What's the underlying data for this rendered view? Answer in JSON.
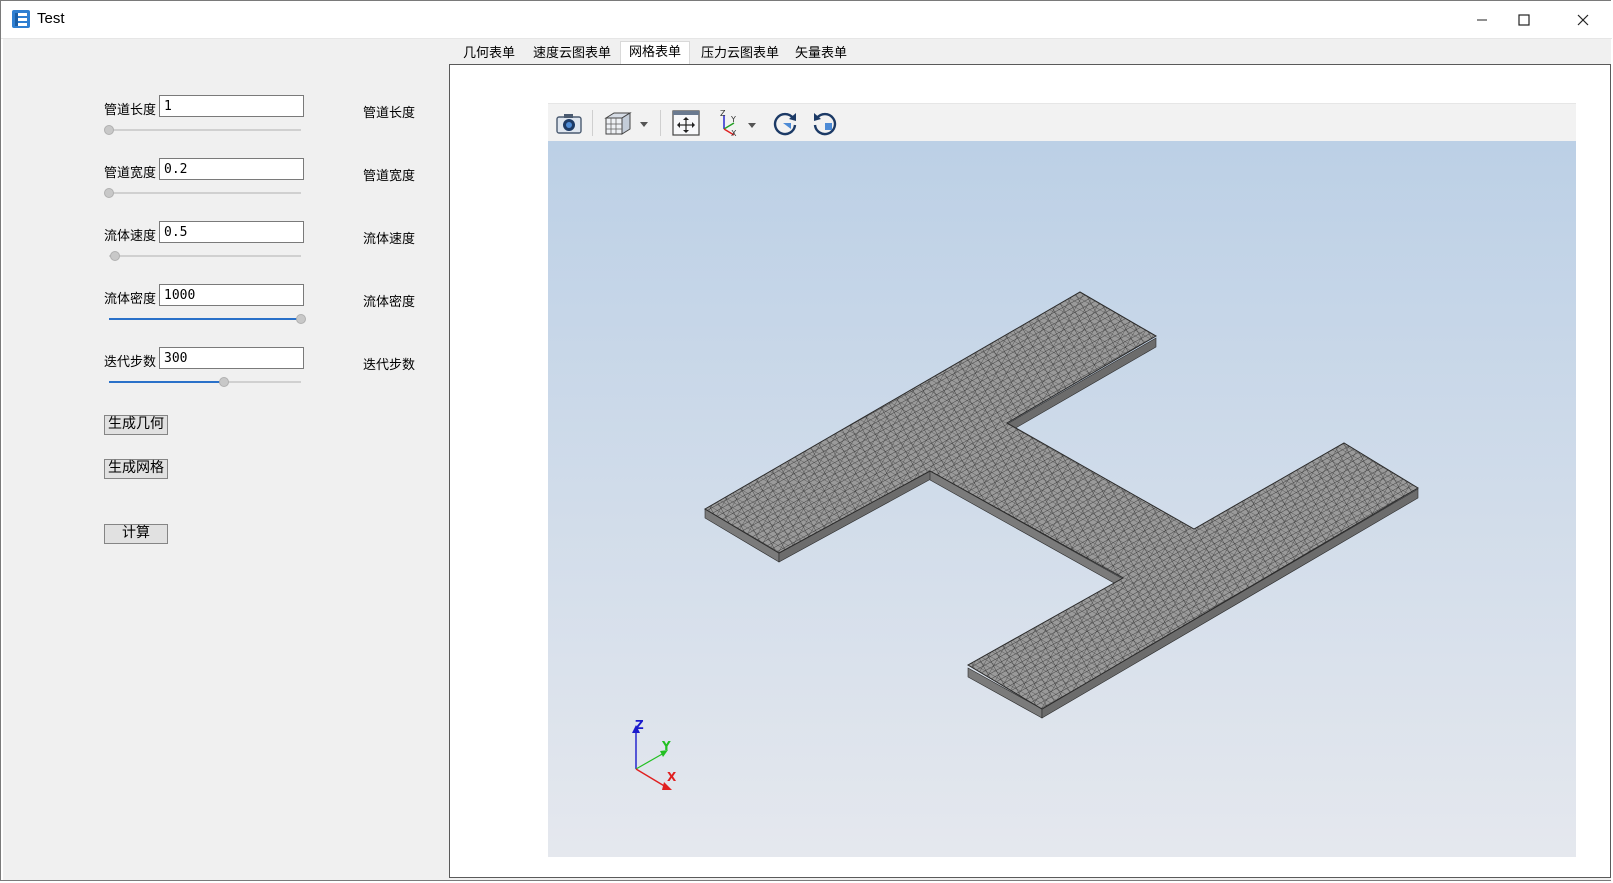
{
  "window": {
    "title": "Test"
  },
  "titlebar_buttons": [
    {
      "name": "minimize-button",
      "icon": "minimize-icon"
    },
    {
      "name": "maximize-button",
      "icon": "maximize-icon"
    },
    {
      "name": "close-button",
      "icon": "close-icon"
    }
  ],
  "params": [
    {
      "label": "管道长度",
      "value": "1",
      "right_label": "管道长度",
      "slider": 0.0
    },
    {
      "label": "管道宽度",
      "value": "0.2",
      "right_label": "管道宽度",
      "slider": 0.0
    },
    {
      "label": "流体速度",
      "value": "0.5",
      "right_label": "流体速度",
      "slider": 0.03
    },
    {
      "label": "流体密度",
      "value": "1000",
      "right_label": "流体密度",
      "slider": 1.0
    },
    {
      "label": "迭代步数",
      "value": "300",
      "right_label": "迭代步数",
      "slider": 0.6
    }
  ],
  "buttons": {
    "gen_geometry": "生成几何",
    "gen_mesh": "生成网格",
    "compute": "计算"
  },
  "tabs": [
    "几何表单",
    "速度云图表单",
    "网格表单",
    "压力云图表单",
    "矢量表单"
  ],
  "active_tab": "网格表单",
  "viewer": {
    "toolbar": [
      "camera-icon",
      "cube-view-icon",
      "fit-view-icon",
      "axes-icon",
      "rotate-cw-icon",
      "rotate-ccw-icon"
    ],
    "axes": {
      "x": "X",
      "y": "Y",
      "z": "Z"
    },
    "axes_colors": {
      "x": "#e02020",
      "y": "#22c022",
      "z": "#1a1acc"
    },
    "mesh_color": "#9a9a9a"
  }
}
